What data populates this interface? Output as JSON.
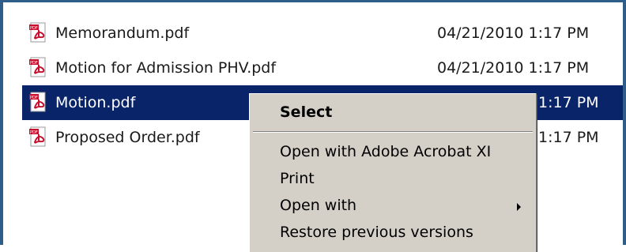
{
  "files": [
    {
      "name": "Memorandum.pdf",
      "date": "04/21/2010 1:17 PM",
      "icon": "pdf-icon",
      "selected": false
    },
    {
      "name": "Motion for Admission PHV.pdf",
      "date": "04/21/2010 1:17 PM",
      "icon": "pdf-icon",
      "selected": false
    },
    {
      "name": "Motion.pdf",
      "date": "1:17 PM",
      "icon": "pdf-icon",
      "selected": true
    },
    {
      "name": "Proposed Order.pdf",
      "date": "1:17 PM",
      "icon": "pdf-icon",
      "selected": false
    }
  ],
  "context_menu": {
    "items": [
      {
        "label": "Select",
        "bold": true
      },
      {
        "label": "Open with Adobe Acrobat XI",
        "bold": false
      },
      {
        "label": "Print",
        "bold": false
      },
      {
        "label": "Open with",
        "bold": false,
        "has_submenu": true
      },
      {
        "label": "Restore previous versions",
        "bold": false
      }
    ]
  },
  "colors": {
    "selection": "#0a246a",
    "menu_background": "#d4d0c8",
    "frame_border": "#2f5d8a",
    "pdf_icon_red": "#c8102e"
  }
}
